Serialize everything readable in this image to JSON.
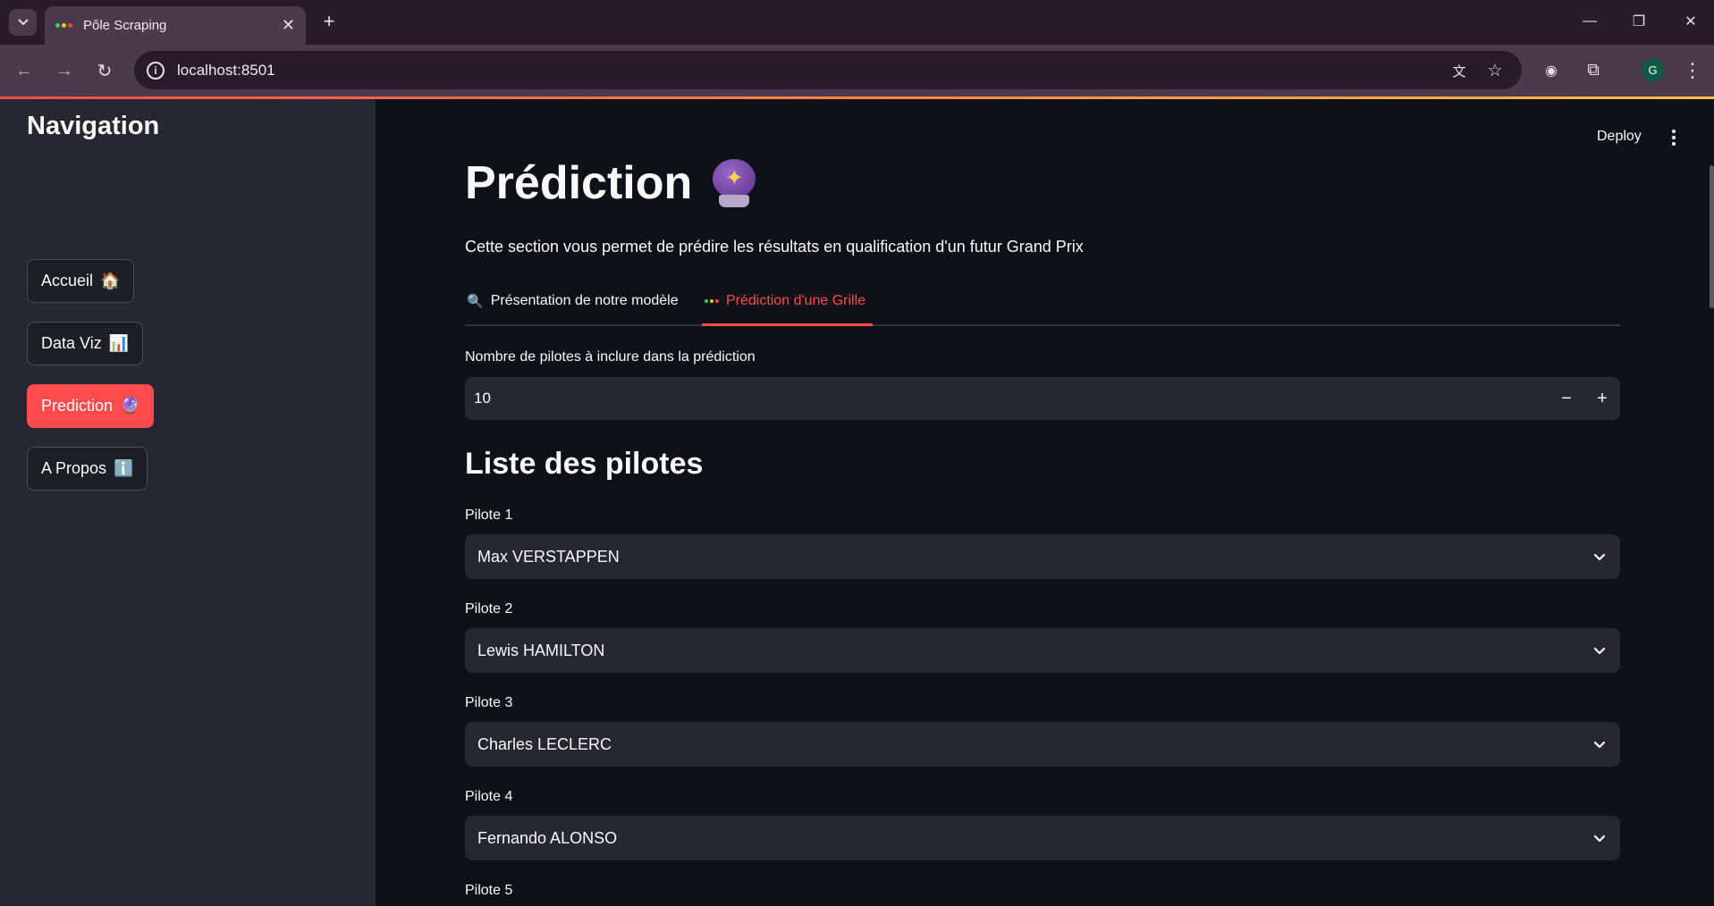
{
  "browser": {
    "tab_title": "Pôle Scraping",
    "url": "localhost:8501"
  },
  "sidebar": {
    "heading": "Navigation",
    "items": [
      {
        "label": "Accueil",
        "emoji": "🏠"
      },
      {
        "label": "Data Viz",
        "emoji": "📊"
      },
      {
        "label": "Prediction",
        "emoji": "🔮"
      },
      {
        "label": "A Propos",
        "emoji": "ℹ️"
      }
    ]
  },
  "header": {
    "deploy_label": "Deploy"
  },
  "main": {
    "title": "Prédiction",
    "subtitle": "Cette section vous permet de prédire les résultats en qualification d'un futur Grand Prix",
    "tabs": [
      {
        "label": "Présentation de notre modèle"
      },
      {
        "label": "Prédiction d'une Grille"
      }
    ],
    "pilot_count": {
      "label": "Nombre de pilotes à inclure dans la prédiction",
      "value": "10",
      "minus": "−",
      "plus": "+"
    },
    "pilots_heading": "Liste des pilotes",
    "pilots": [
      {
        "label": "Pilote 1",
        "value": "Max VERSTAPPEN"
      },
      {
        "label": "Pilote 2",
        "value": "Lewis HAMILTON"
      },
      {
        "label": "Pilote 3",
        "value": "Charles LECLERC"
      },
      {
        "label": "Pilote 4",
        "value": "Fernando ALONSO"
      },
      {
        "label": "Pilote 5",
        "value": ""
      }
    ]
  },
  "colors": {
    "accent": "#ff4b4b",
    "background": "#0e1117",
    "sidebar": "#262730"
  }
}
